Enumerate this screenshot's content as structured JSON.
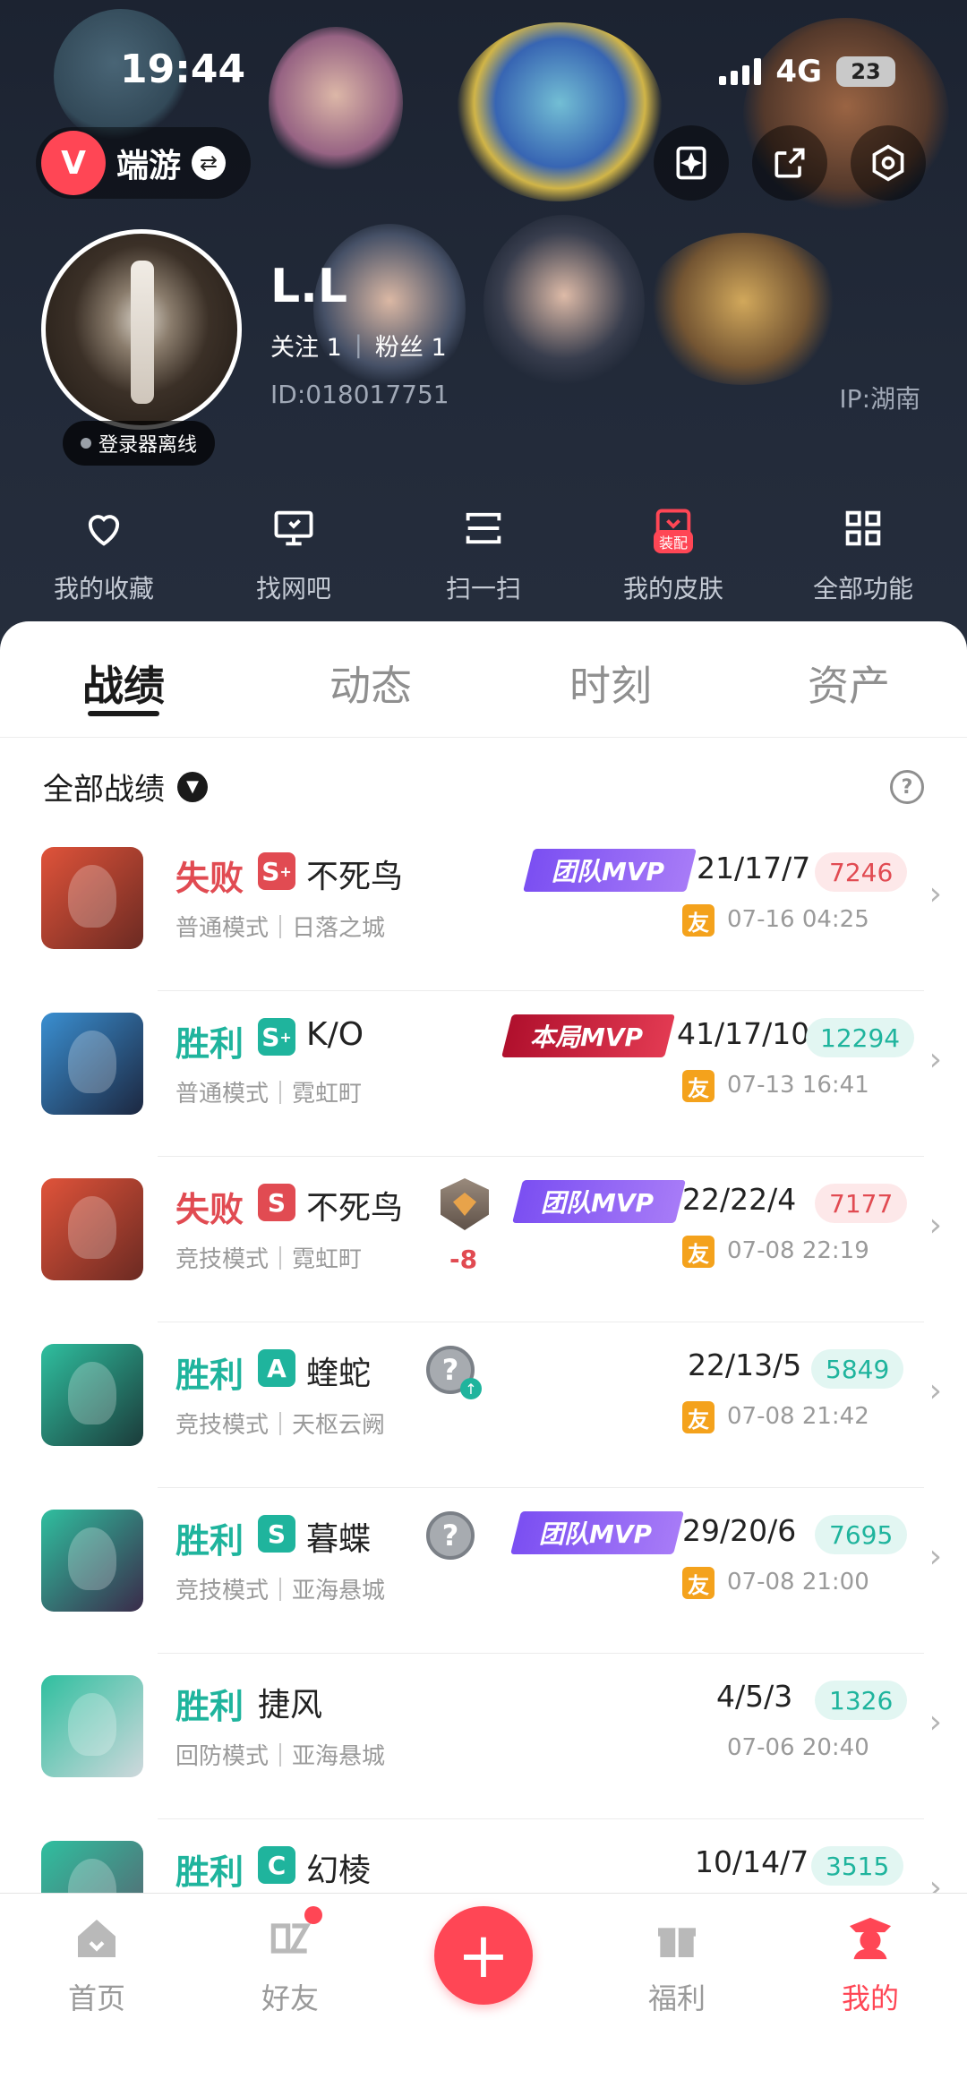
{
  "status_bar": {
    "time": "19:44",
    "network": "4G",
    "battery": "23"
  },
  "app": {
    "name": "端游",
    "logo": "V"
  },
  "header_icons": [
    "sparkle-card-icon",
    "share-icon",
    "settings-hex-icon"
  ],
  "profile": {
    "username": "L.L",
    "following_label": "关注",
    "following_count": "1",
    "followers_label": "粉丝",
    "followers_count": "1",
    "id": "ID:018017751",
    "ip": "IP:湖南",
    "login_status": "登录器离线"
  },
  "quick_actions": [
    {
      "label": "我的收藏",
      "icon": "heart-icon"
    },
    {
      "label": "找网吧",
      "icon": "monitor-icon"
    },
    {
      "label": "扫一扫",
      "icon": "scan-icon"
    },
    {
      "label": "我的皮肤",
      "icon": "skin-icon",
      "badge": "装配"
    },
    {
      "label": "全部功能",
      "icon": "grid-icon"
    }
  ],
  "tabs": [
    "战绩",
    "动态",
    "时刻",
    "资产"
  ],
  "filter": {
    "label": "全部战绩"
  },
  "colors": {
    "accent": "#ff4655",
    "win": "#1fb49d",
    "loss": "#e14b52",
    "team_mvp": "#7b4ff2",
    "match_mvp": "#d4213d"
  },
  "matches": [
    {
      "result": "失败",
      "outcome": "loss",
      "rank": "S",
      "rank_plus": true,
      "agent": "不死鸟",
      "mode": "普通模式｜日落之城",
      "mvp": "团队MVP",
      "mvp_type": "team",
      "kda": "21/17/7",
      "score": "7246",
      "friend": "友",
      "date": "07-16 04:25"
    },
    {
      "result": "胜利",
      "outcome": "win",
      "rank": "S",
      "rank_plus": true,
      "agent": "K/O",
      "mode": "普通模式｜霓虹町",
      "mvp": "本局MVP",
      "mvp_type": "match",
      "kda": "41/17/10",
      "score": "12294",
      "friend": "友",
      "date": "07-13 16:41"
    },
    {
      "result": "失败",
      "outcome": "loss",
      "rank": "S",
      "rank_plus": false,
      "agent": "不死鸟",
      "mode": "竞技模式｜霓虹町",
      "mvp": "团队MVP",
      "mvp_type": "team",
      "kda": "22/22/4",
      "score": "7177",
      "friend": "友",
      "date": "07-08 22:19",
      "rr_delta": "-8"
    },
    {
      "result": "胜利",
      "outcome": "win",
      "rank": "A",
      "rank_plus": false,
      "agent": "蝰蛇",
      "mode": "竞技模式｜天枢云阙",
      "mvp": "",
      "mvp_type": "",
      "kda": "22/13/5",
      "score": "5849",
      "friend": "友",
      "date": "07-08 21:42"
    },
    {
      "result": "胜利",
      "outcome": "win",
      "rank": "S",
      "rank_plus": false,
      "agent": "暮蝶",
      "mode": "竞技模式｜亚海悬城",
      "mvp": "团队MVP",
      "mvp_type": "team",
      "kda": "29/20/6",
      "score": "7695",
      "friend": "友",
      "date": "07-08 21:00"
    },
    {
      "result": "胜利",
      "outcome": "win",
      "rank": "",
      "rank_plus": false,
      "agent": "捷风",
      "mode": "回防模式｜亚海悬城",
      "mvp": "",
      "mvp_type": "",
      "kda": "4/5/3",
      "score": "1326",
      "friend": "",
      "date": "07-06 20:40"
    },
    {
      "result": "胜利",
      "outcome": "win",
      "rank": "C",
      "rank_plus": false,
      "agent": "幻棱",
      "mode": "",
      "mvp": "",
      "mvp_type": "",
      "kda": "10/14/7",
      "score": "3515",
      "friend": "",
      "date": ""
    }
  ],
  "bottom_nav": [
    {
      "label": "首页",
      "icon": "home-icon"
    },
    {
      "label": "好友",
      "icon": "friends-icon",
      "dot": true
    },
    {
      "label": "福利",
      "icon": "gift-icon"
    },
    {
      "label": "我的",
      "icon": "profile-icon",
      "active": true
    }
  ],
  "add_button": "+"
}
